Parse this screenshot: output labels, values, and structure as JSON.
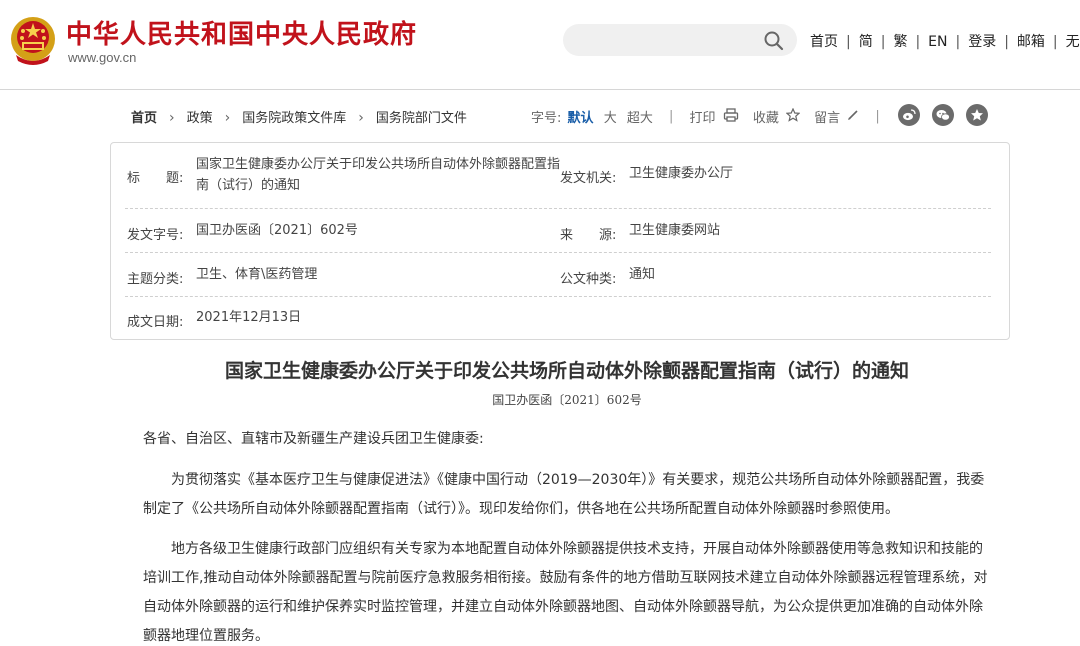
{
  "header": {
    "site_title": "中华人民共和国中央人民政府",
    "site_url": "www.gov.cn",
    "search_placeholder": "",
    "nav": [
      "首页",
      "简",
      "繁",
      "EN",
      "登录",
      "邮箱",
      "无"
    ],
    "colors": {
      "brand_red": "#c1121b",
      "accent_blue": "#1a5ea8"
    }
  },
  "breadcrumb": [
    "首页",
    "政策",
    "国务院政策文件库",
    "国务院部门文件"
  ],
  "tools": {
    "font_size_label": "字号:",
    "font_default": "默认",
    "font_large": "大",
    "font_xlarge": "超大",
    "print": "打印",
    "favorite": "收藏",
    "comment": "留言"
  },
  "share_icons": [
    "weibo-icon",
    "wechat-icon",
    "star-icon"
  ],
  "info": {
    "title_label": "标　　题:",
    "title_value": "国家卫生健康委办公厅关于印发公共场所自动体外除颤器配置指南（试行）的通知",
    "issuer_label": "发文机关:",
    "issuer_value": "卫生健康委办公厅",
    "doc_no_label": "发文字号:",
    "doc_no_value": "国卫办医函〔2021〕602号",
    "source_label": "来　　源:",
    "source_value": "卫生健康委网站",
    "category_label": "主题分类:",
    "category_value": "卫生、体育\\医药管理",
    "type_label": "公文种类:",
    "type_value": "通知",
    "date_label": "成文日期:",
    "date_value": "2021年12月13日"
  },
  "article": {
    "title": "国家卫生健康委办公厅关于印发公共场所自动体外除颤器配置指南（试行）的通知",
    "doc_number": "国卫办医函〔2021〕602号",
    "salutation": "各省、自治区、直辖市及新疆生产建设兵团卫生健康委:",
    "para1": "为贯彻落实《基本医疗卫生与健康促进法》《健康中国行动（2019—2030年）》有关要求，规范公共场所自动体外除颤器配置，我委制定了《公共场所自动体外除颤器配置指南（试行）》。现印发给你们，供各地在公共场所配置自动体外除颤器时参照使用。",
    "para2": "地方各级卫生健康行政部门应组织有关专家为本地配置自动体外除颤器提供技术支持，开展自动体外除颤器使用等急救知识和技能的培训工作,推动自动体外除颤器配置与院前医疗急救服务相衔接。鼓励有条件的地方借助互联网技术建立自动体外除颤器远程管理系统，对自动体外除颤器的运行和维护保养实时监控管理，并建立自动体外除颤器地图、自动体外除颤器导航，为公众提供更加准确的自动体外除颤器地理位置服务。"
  }
}
